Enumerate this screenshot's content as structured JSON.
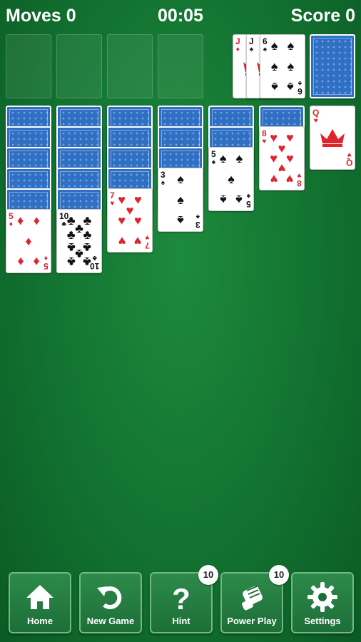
{
  "hud": {
    "moves": "Moves 0",
    "time": "00:05",
    "score": "Score 0"
  },
  "waste": [
    {
      "rank": "J",
      "suit": "♦",
      "color": "red"
    },
    {
      "rank": "J",
      "suit": "♠",
      "color": "black"
    },
    {
      "rank": "6",
      "suit": "♠",
      "color": "black"
    }
  ],
  "tableau": [
    {
      "down": 5,
      "up": [
        {
          "rank": "5",
          "suit": "♦",
          "color": "red"
        }
      ]
    },
    {
      "down": 5,
      "up": [
        {
          "rank": "10",
          "suit": "♣",
          "color": "black"
        }
      ]
    },
    {
      "down": 4,
      "up": [
        {
          "rank": "7",
          "suit": "♥",
          "color": "red"
        }
      ]
    },
    {
      "down": 3,
      "up": [
        {
          "rank": "3",
          "suit": "♠",
          "color": "black"
        }
      ]
    },
    {
      "down": 2,
      "up": [
        {
          "rank": "5",
          "suit": "♠",
          "color": "black"
        }
      ]
    },
    {
      "down": 1,
      "up": [
        {
          "rank": "8",
          "suit": "♥",
          "color": "red"
        }
      ]
    },
    {
      "down": 0,
      "up": [
        {
          "rank": "Q",
          "suit": "♥",
          "color": "red"
        }
      ]
    }
  ],
  "toolbar": {
    "home": "Home",
    "new_game": "New Game",
    "hint": "Hint",
    "hint_count": "10",
    "power_play": "Power Play",
    "power_play_count": "10",
    "settings": "Settings"
  },
  "colors": {
    "felt": "#127230",
    "card_back": "#2f6fc4",
    "red_suit": "#e0242d"
  }
}
